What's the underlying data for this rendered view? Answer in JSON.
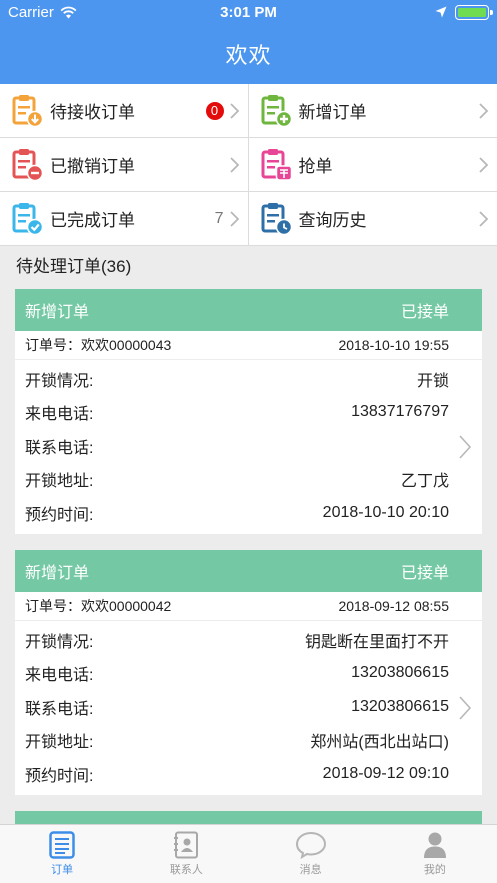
{
  "status_bar": {
    "carrier": "Carrier",
    "time": "3:01 PM"
  },
  "nav": {
    "title": "欢欢"
  },
  "menu": [
    {
      "label": "待接收订单",
      "badge": "0",
      "icon": "clipboard-download-icon"
    },
    {
      "label": "新增订单",
      "icon": "clipboard-add-icon"
    },
    {
      "label": "已撤销订单",
      "icon": "clipboard-minus-icon"
    },
    {
      "label": "抢单",
      "icon": "clipboard-grab-icon"
    },
    {
      "label": "已完成订单",
      "count": "7",
      "icon": "clipboard-check-icon"
    },
    {
      "label": "查询历史",
      "icon": "clipboard-clock-icon"
    }
  ],
  "section": {
    "title": "待处理订单(36)"
  },
  "orders": [
    {
      "type": "新增订单",
      "status": "已接单",
      "order_no": "订单号：欢欢00000043",
      "order_time": "2018-10-10 19:55",
      "rows": [
        {
          "label": "开锁情况:",
          "value": "开锁"
        },
        {
          "label": "来电电话:",
          "value": "13837176797"
        },
        {
          "label": "联系电话:",
          "value": ""
        },
        {
          "label": "开锁地址:",
          "value": "乙丁戊"
        },
        {
          "label": "预约时间:",
          "value": "2018-10-10 20:10"
        }
      ]
    },
    {
      "type": "新增订单",
      "status": "已接单",
      "order_no": "订单号：欢欢00000042",
      "order_time": "2018-09-12 08:55",
      "rows": [
        {
          "label": "开锁情况:",
          "value": "钥匙断在里面打不开"
        },
        {
          "label": "来电电话:",
          "value": "13203806615"
        },
        {
          "label": "联系电话:",
          "value": "13203806615"
        },
        {
          "label": "开锁地址:",
          "value": "郑州站(西北出站口)"
        },
        {
          "label": "预约时间:",
          "value": "2018-09-12 09:10"
        }
      ]
    }
  ],
  "tabs": [
    {
      "label": "订单",
      "icon": "order-list-icon",
      "active": true
    },
    {
      "label": "联系人",
      "icon": "contacts-icon"
    },
    {
      "label": "消息",
      "icon": "message-bubble-icon"
    },
    {
      "label": "我的",
      "icon": "profile-icon"
    }
  ],
  "colors": {
    "nav_blue": "#4d96f0",
    "card_header_green": "#74c9a4",
    "badge_red": "#e40b0b",
    "tab_active": "#3d8de8"
  }
}
